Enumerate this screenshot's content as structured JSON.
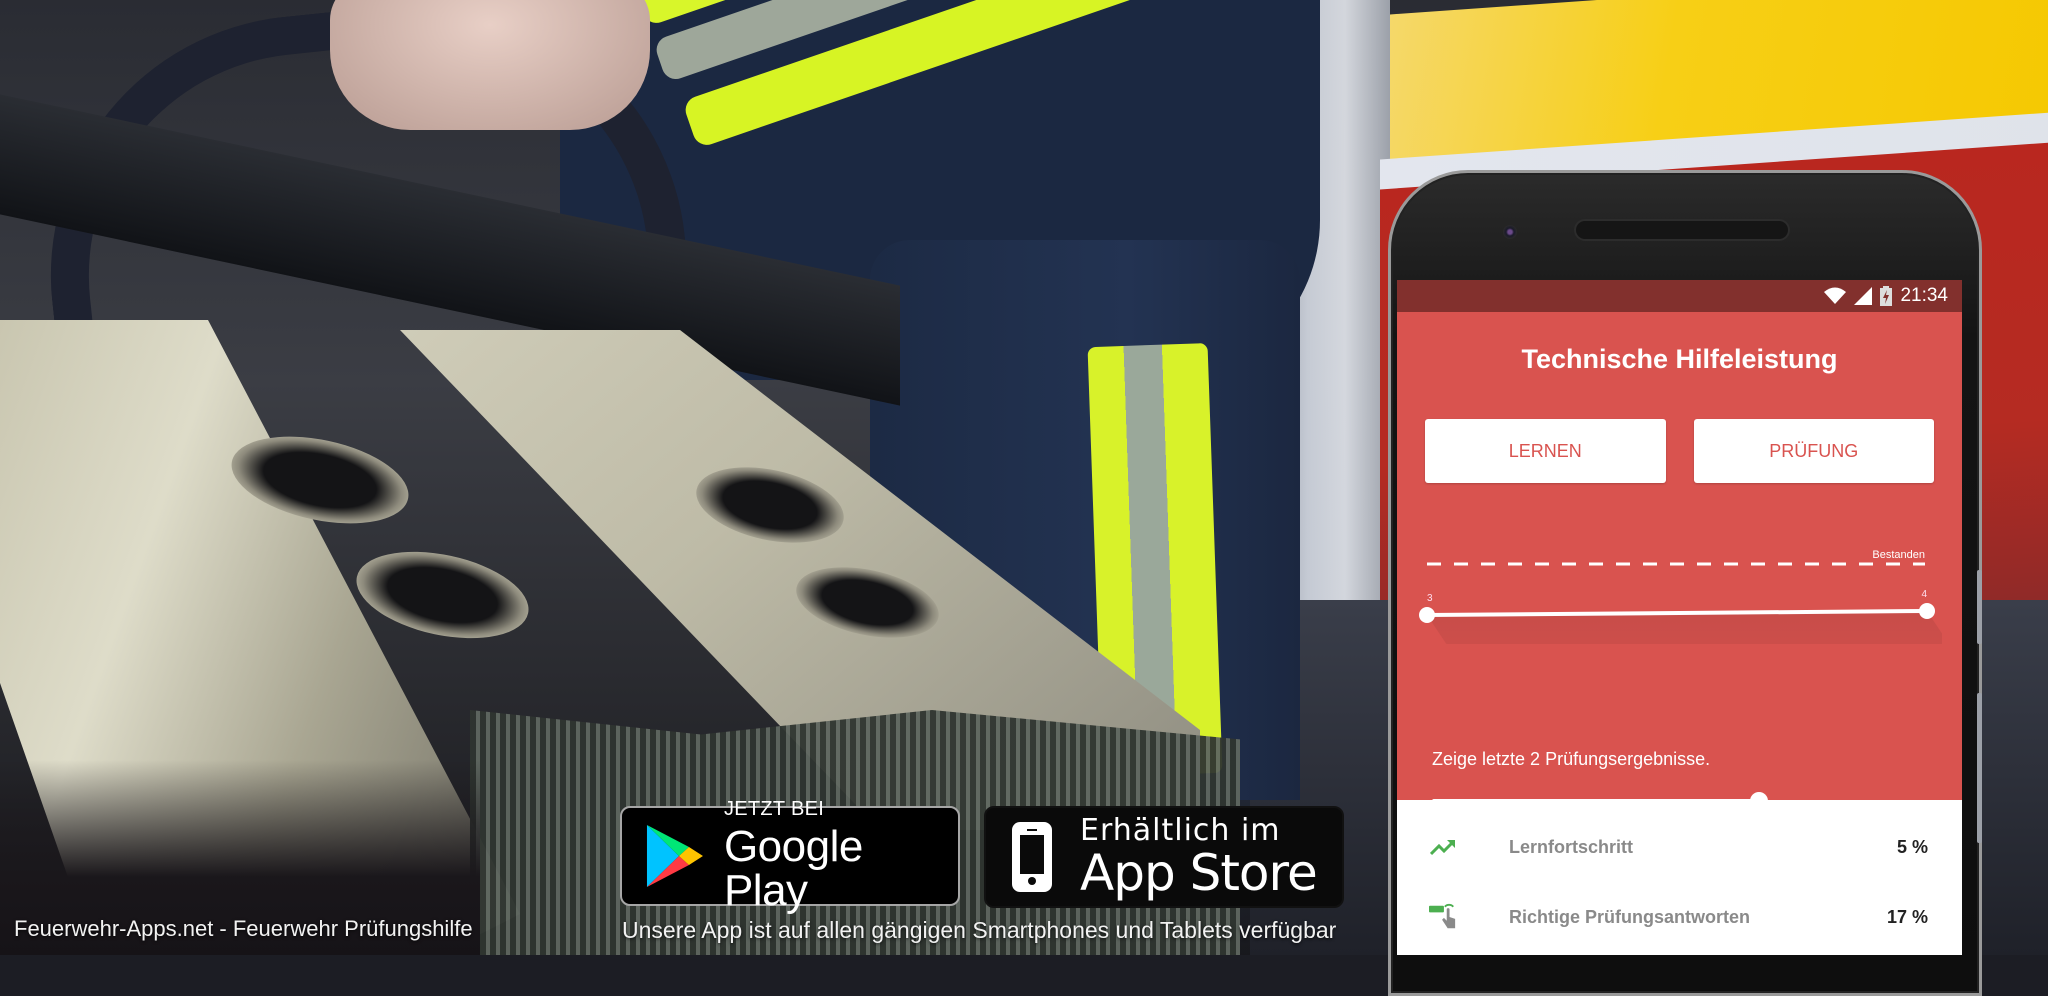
{
  "banner": {
    "site_caption": "Feuerwehr-Apps.net - Feuerwehr Prüfungshilfe",
    "availability_caption": "Unsere App ist auf allen gängigen Smartphones und Tablets verfügbar",
    "google_play": {
      "small": "JETZT BEI",
      "big": "Google Play",
      "icon": "google-play-icon"
    },
    "app_store": {
      "small": "Erhältlich im",
      "big": "App Store",
      "icon": "iphone-icon"
    }
  },
  "phone": {
    "status_bar": {
      "time": "21:34",
      "icons": [
        "wifi-icon",
        "signal-icon",
        "battery-charging-icon"
      ]
    },
    "app": {
      "title": "Technische Hilfeleistung",
      "buttons": {
        "learn": "LERNEN",
        "exam": "PRÜFUNG"
      },
      "colors": {
        "primary": "#d9534f",
        "status_bar": "#82302d",
        "accent_green": "#4caf50"
      },
      "progress_chart": {
        "type": "line",
        "limit_label": "Bestanden",
        "limit_value": 4.5,
        "points": [
          {
            "label": "3",
            "value": 3
          },
          {
            "label": "4",
            "value": 4
          }
        ]
      },
      "result_filter": {
        "text": "Zeige letzte 2 Prüfungsergebnisse.",
        "slider_fraction": 0.66
      },
      "stats": [
        {
          "icon": "trending-up-icon",
          "label": "Lernfortschritt",
          "value": "5 %"
        },
        {
          "icon": "touch-answer-icon",
          "label": "Richtige Prüfungsantworten",
          "value": "17 %"
        }
      ]
    }
  }
}
